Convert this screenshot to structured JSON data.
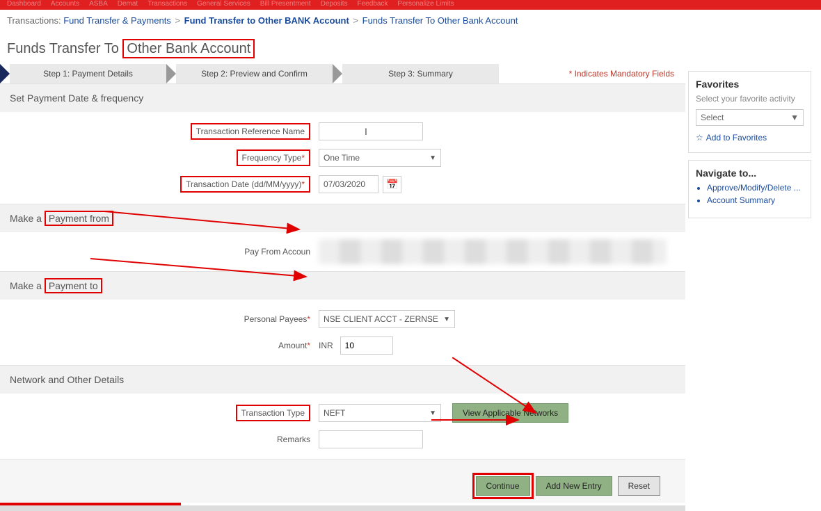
{
  "topnav": [
    "Dashboard",
    "Accounts",
    "ASBA",
    "Demat",
    "Transactions",
    "General Services",
    "Bill Presentment",
    "Deposits",
    "Feedback",
    "Personalize Limits"
  ],
  "breadcrumb": {
    "root": "Transactions:",
    "a": "Fund Transfer & Payments",
    "b": "Fund Transfer to Other BANK Account",
    "c": "Funds Transfer To Other Bank Account"
  },
  "page_title_pre": "Funds Transfer To ",
  "page_title_hl": "Other Bank Account",
  "steps": {
    "s1": "Step 1: Payment Details",
    "s2": "Step 2: Preview and Confirm",
    "s3": "Step 3: Summary"
  },
  "mandatory": "* Indicates Mandatory Fields",
  "sections": {
    "date_freq": "Set Payment Date & frequency",
    "pay_from_pre": "Make a ",
    "pay_from_hl": "Payment from",
    "pay_to_pre": "Make a ",
    "pay_to_hl": "Payment to",
    "network": "Network and Other Details"
  },
  "labels": {
    "txn_ref": "Transaction Reference Name",
    "freq_type": "Frequency Type",
    "txn_date": "Transaction Date (dd/MM/yyyy)",
    "pay_from_acct": "Pay From Accoun",
    "payees": "Personal Payees",
    "amount": "Amount",
    "txn_type": "Transaction Type",
    "remarks": "Remarks"
  },
  "values": {
    "freq_type": "One Time",
    "txn_date": "07/03/2020",
    "payee_selected": "NSE CLIENT ACCT - ZERNSE",
    "currency": "INR",
    "amount": "10",
    "txn_type": "NEFT"
  },
  "buttons": {
    "view_networks": "View Applicable Networks",
    "continue": "Continue",
    "add_new": "Add New Entry",
    "reset": "Reset"
  },
  "sidebar": {
    "fav_title": "Favorites",
    "fav_sub": "Select your favorite activity",
    "fav_select": "Select",
    "fav_add": "Add to Favorites",
    "nav_title": "Navigate to...",
    "nav_items": [
      "Approve/Modify/Delete ...",
      "Account Summary"
    ]
  }
}
